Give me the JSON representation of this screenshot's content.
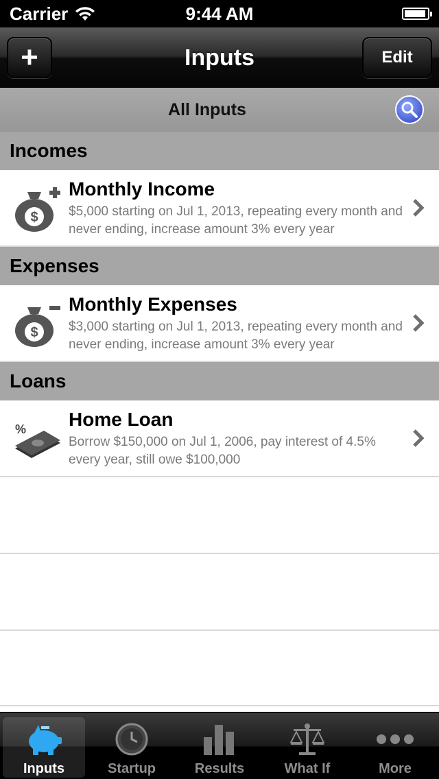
{
  "status_bar": {
    "carrier": "Carrier",
    "time": "9:44 AM",
    "battery_level": 0.95
  },
  "nav": {
    "title": "Inputs",
    "add_label": "+",
    "edit_label": "Edit"
  },
  "filter": {
    "label": "All Inputs",
    "search_icon": "search-icon"
  },
  "sections": [
    {
      "header": "Incomes",
      "rows": [
        {
          "title": "Monthly Income",
          "description": "$5,000 starting on Jul 1, 2013, repeating every month and never ending, increase amount 3% every year",
          "icon": "money-bag-plus-icon"
        }
      ]
    },
    {
      "header": "Expenses",
      "rows": [
        {
          "title": "Monthly Expenses",
          "description": "$3,000 starting on Jul 1, 2013, repeating every month and never ending, increase amount 3% every year",
          "icon": "money-bag-minus-icon"
        }
      ]
    },
    {
      "header": "Loans",
      "rows": [
        {
          "title": "Home Loan",
          "description": "Borrow $150,000 on Jul 1, 2006, pay interest of 4.5% every year, still owe $100,000",
          "icon": "cash-percent-icon"
        }
      ]
    }
  ],
  "tabs": [
    {
      "label": "Inputs",
      "icon": "piggy-bank-icon",
      "selected": true
    },
    {
      "label": "Startup",
      "icon": "clock-icon",
      "selected": false
    },
    {
      "label": "Results",
      "icon": "bar-chart-icon",
      "selected": false
    },
    {
      "label": "What If",
      "icon": "scales-icon",
      "selected": false
    },
    {
      "label": "More",
      "icon": "more-dots-icon",
      "selected": false
    }
  ],
  "colors": {
    "section_header_bg": "#a6a6a6",
    "description_text": "#7a7a7a",
    "tab_selected_icon": "#2ea8f0"
  }
}
